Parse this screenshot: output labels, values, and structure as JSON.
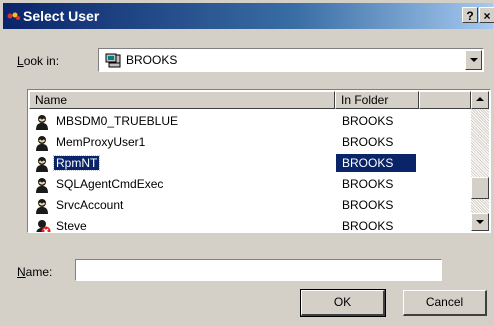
{
  "window": {
    "title": "Select User",
    "help_label": "?",
    "close_label": "×"
  },
  "lookin": {
    "label_prefix": "L",
    "label_rest": "ook in:",
    "value": "BROOKS"
  },
  "list": {
    "headers": [
      "Name",
      "In Folder"
    ],
    "rows": [
      {
        "name": "MBSDM0_TRUEBLUE",
        "folder": "BROOKS",
        "icon": "user-icon",
        "selected": false
      },
      {
        "name": "MemProxyUser1",
        "folder": "BROOKS",
        "icon": "user-icon",
        "selected": false
      },
      {
        "name": "RpmNT",
        "folder": "BROOKS",
        "icon": "user-icon",
        "selected": true
      },
      {
        "name": "SQLAgentCmdExec",
        "folder": "BROOKS",
        "icon": "user-icon",
        "selected": false
      },
      {
        "name": "SrvcAccount",
        "folder": "BROOKS",
        "icon": "user-icon",
        "selected": false
      },
      {
        "name": "Steve",
        "folder": "BROOKS",
        "icon": "disabled-user-icon",
        "selected": false
      }
    ]
  },
  "name_field": {
    "label_prefix": "N",
    "label_rest": "ame:",
    "value": ""
  },
  "buttons": {
    "ok": "OK",
    "cancel": "Cancel"
  },
  "colors": {
    "title_bar": "#0a246a",
    "selection": "#0a246a",
    "dialog_face": "#d4d0c8"
  }
}
